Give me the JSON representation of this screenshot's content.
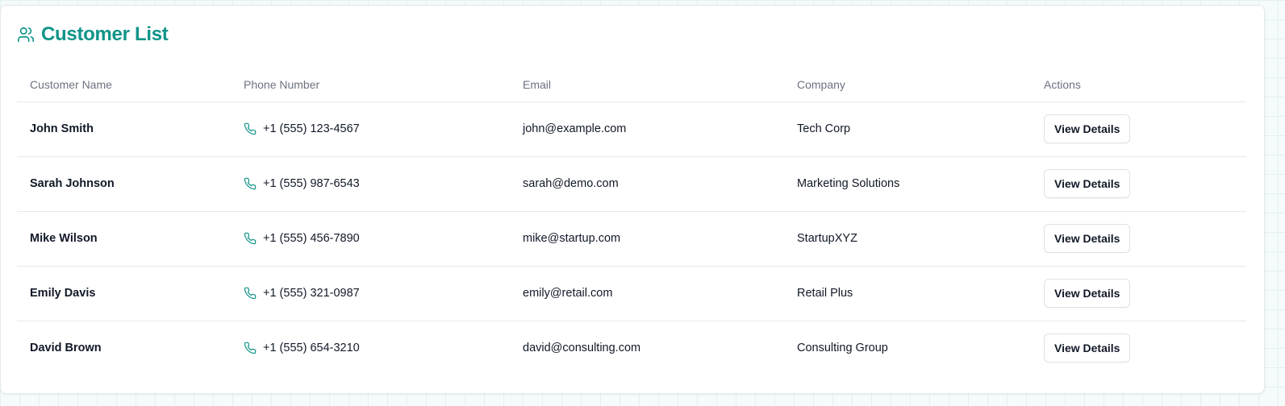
{
  "header": {
    "title": "Customer List",
    "icon": "users-icon"
  },
  "table": {
    "columns": [
      "Customer Name",
      "Phone Number",
      "Email",
      "Company",
      "Actions"
    ],
    "rows": [
      {
        "name": "John Smith",
        "phone": "+1 (555) 123-4567",
        "email": "john@example.com",
        "company": "Tech Corp",
        "action": "View Details"
      },
      {
        "name": "Sarah Johnson",
        "phone": "+1 (555) 987-6543",
        "email": "sarah@demo.com",
        "company": "Marketing Solutions",
        "action": "View Details"
      },
      {
        "name": "Mike Wilson",
        "phone": "+1 (555) 456-7890",
        "email": "mike@startup.com",
        "company": "StartupXYZ",
        "action": "View Details"
      },
      {
        "name": "Emily Davis",
        "phone": "+1 (555) 321-0987",
        "email": "emily@retail.com",
        "company": "Retail Plus",
        "action": "View Details"
      },
      {
        "name": "David Brown",
        "phone": "+1 (555) 654-3210",
        "email": "david@consulting.com",
        "company": "Consulting Group",
        "action": "View Details"
      }
    ]
  },
  "colors": {
    "accent": "#0f9488",
    "text": "#111827",
    "muted": "#6b7280",
    "border": "#e5e7eb"
  }
}
